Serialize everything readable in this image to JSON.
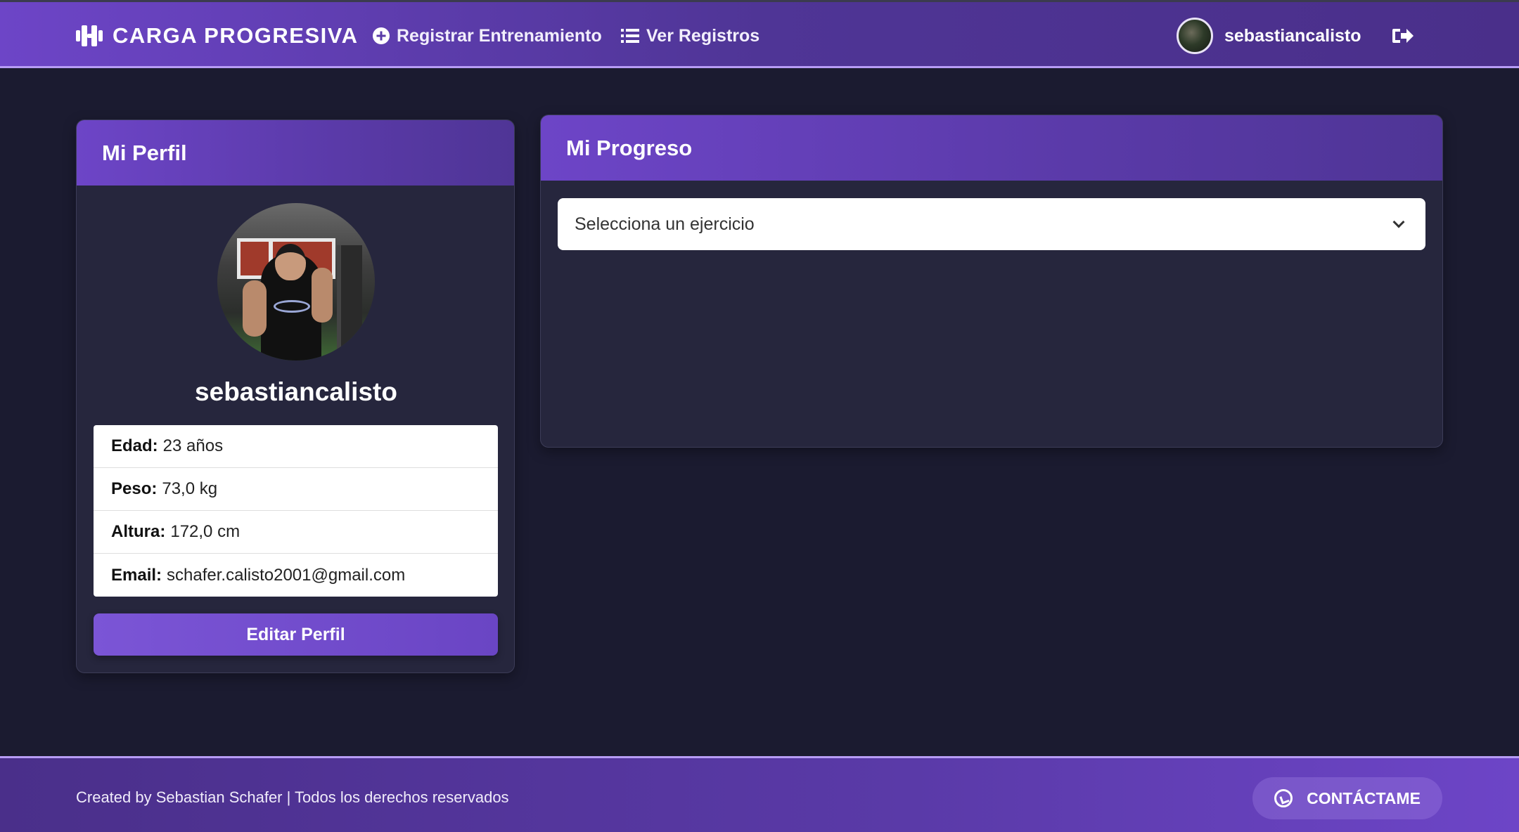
{
  "navbar": {
    "brand": "CARGA PROGRESIVA",
    "links": [
      {
        "label": "Registrar Entrenamiento"
      },
      {
        "label": "Ver Registros"
      }
    ],
    "user": {
      "username": "sebastiancalisto"
    }
  },
  "profile": {
    "title": "Mi Perfil",
    "username": "sebastiancalisto",
    "fields": [
      {
        "label": "Edad:",
        "value": "23 años"
      },
      {
        "label": "Peso:",
        "value": "73,0 kg"
      },
      {
        "label": "Altura:",
        "value": "172,0 cm"
      },
      {
        "label": "Email:",
        "value": "schafer.calisto2001@gmail.com"
      }
    ],
    "edit_label": "Editar Perfil"
  },
  "progress": {
    "title": "Mi Progreso",
    "select_value": "Selecciona un ejercicio"
  },
  "footer": {
    "credits": "Created by Sebastian Schafer | Todos los derechos reservados",
    "contact_label": "CONTÁCTAME"
  },
  "colors": {
    "accent": "#6d45c7",
    "background": "#1b1b30",
    "card": "#26263d"
  },
  "icons": [
    "dumbbell-icon",
    "plus-circle-icon",
    "list-icon",
    "logout-icon",
    "whatsapp-icon"
  ]
}
